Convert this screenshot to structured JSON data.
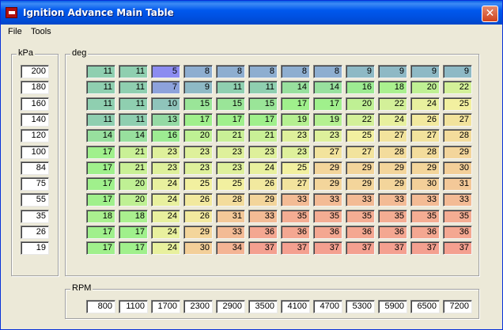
{
  "window": {
    "title": "Ignition Advance Main Table",
    "close_label": "✕"
  },
  "menu": [
    "File",
    "Tools"
  ],
  "groups": {
    "kpa_label": "kPa",
    "deg_label": "deg",
    "rpm_label": "RPM"
  },
  "kpa": [
    "200",
    "180",
    "160",
    "140",
    "120",
    "100",
    "84",
    "75",
    "55",
    "35",
    "26",
    "19"
  ],
  "rpm": [
    "800",
    "1100",
    "1700",
    "2300",
    "2900",
    "3500",
    "4100",
    "4700",
    "5300",
    "5900",
    "6500",
    "7200"
  ],
  "table": [
    [
      11,
      11,
      5,
      8,
      8,
      8,
      8,
      8,
      9,
      9,
      9,
      9
    ],
    [
      11,
      11,
      7,
      9,
      11,
      11,
      14,
      14,
      16,
      18,
      20,
      22
    ],
    [
      11,
      11,
      10,
      15,
      15,
      15,
      17,
      17,
      20,
      22,
      24,
      25
    ],
    [
      11,
      11,
      13,
      17,
      17,
      17,
      19,
      19,
      22,
      24,
      26,
      27
    ],
    [
      14,
      14,
      16,
      20,
      21,
      21,
      23,
      23,
      25,
      27,
      27,
      28
    ],
    [
      17,
      21,
      23,
      23,
      23,
      23,
      23,
      27,
      27,
      28,
      28,
      29
    ],
    [
      17,
      21,
      23,
      23,
      23,
      24,
      25,
      29,
      29,
      29,
      29,
      30
    ],
    [
      17,
      20,
      24,
      25,
      25,
      26,
      27,
      29,
      29,
      29,
      30,
      31
    ],
    [
      17,
      20,
      24,
      26,
      28,
      29,
      33,
      33,
      33,
      33,
      33,
      33
    ],
    [
      18,
      18,
      24,
      26,
      31,
      33,
      35,
      35,
      35,
      35,
      35,
      35
    ],
    [
      17,
      17,
      24,
      29,
      33,
      36,
      36,
      36,
      36,
      36,
      36,
      36
    ],
    [
      17,
      17,
      24,
      30,
      34,
      37,
      37,
      37,
      37,
      37,
      37,
      37
    ]
  ],
  "colors": {
    "low": "#8c8cf0",
    "mid_low": "#8fcfb0",
    "mid": "#a0f08c",
    "mid_high": "#f2f0a0",
    "high": "#f4a090",
    "title_bar": "#0058ee"
  }
}
